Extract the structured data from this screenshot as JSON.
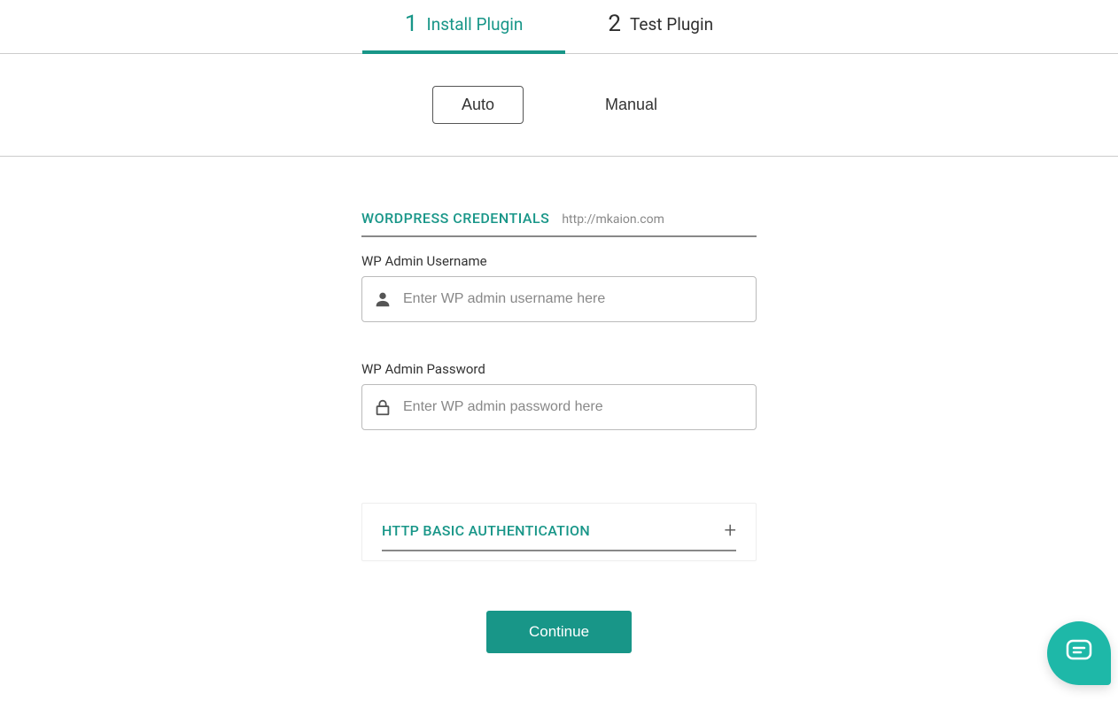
{
  "steps": [
    {
      "number": "1",
      "label": "Install Plugin",
      "active": true
    },
    {
      "number": "2",
      "label": "Test Plugin",
      "active": false
    }
  ],
  "modes": {
    "auto": "Auto",
    "manual": "Manual"
  },
  "credentials": {
    "title": "WORDPRESS CREDENTIALS",
    "url": "http://mkaion.com",
    "username_label": "WP Admin Username",
    "username_placeholder": "Enter WP admin username here",
    "username_value": "",
    "password_label": "WP Admin Password",
    "password_placeholder": "Enter WP admin password here",
    "password_value": ""
  },
  "auth_section": {
    "title": "HTTP BASIC AUTHENTICATION"
  },
  "continue_label": "Continue",
  "colors": {
    "accent": "#189688",
    "chat": "#1eb8a8"
  }
}
